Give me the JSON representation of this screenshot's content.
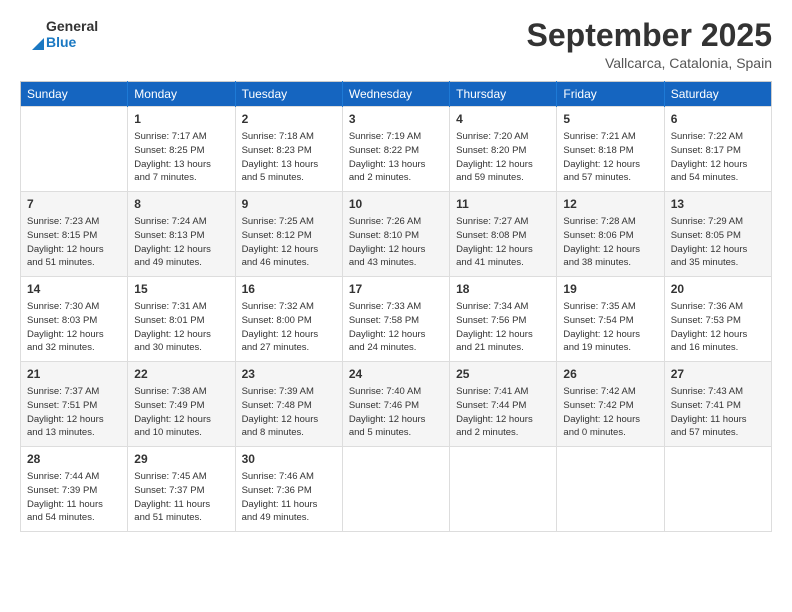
{
  "header": {
    "logo_line1": "General",
    "logo_line2": "Blue",
    "month": "September 2025",
    "location": "Vallcarca, Catalonia, Spain"
  },
  "days": [
    "Sunday",
    "Monday",
    "Tuesday",
    "Wednesday",
    "Thursday",
    "Friday",
    "Saturday"
  ],
  "weeks": [
    [
      {
        "date": "",
        "info": ""
      },
      {
        "date": "1",
        "info": "Sunrise: 7:17 AM\nSunset: 8:25 PM\nDaylight: 13 hours\nand 7 minutes."
      },
      {
        "date": "2",
        "info": "Sunrise: 7:18 AM\nSunset: 8:23 PM\nDaylight: 13 hours\nand 5 minutes."
      },
      {
        "date": "3",
        "info": "Sunrise: 7:19 AM\nSunset: 8:22 PM\nDaylight: 13 hours\nand 2 minutes."
      },
      {
        "date": "4",
        "info": "Sunrise: 7:20 AM\nSunset: 8:20 PM\nDaylight: 12 hours\nand 59 minutes."
      },
      {
        "date": "5",
        "info": "Sunrise: 7:21 AM\nSunset: 8:18 PM\nDaylight: 12 hours\nand 57 minutes."
      },
      {
        "date": "6",
        "info": "Sunrise: 7:22 AM\nSunset: 8:17 PM\nDaylight: 12 hours\nand 54 minutes."
      }
    ],
    [
      {
        "date": "7",
        "info": "Sunrise: 7:23 AM\nSunset: 8:15 PM\nDaylight: 12 hours\nand 51 minutes."
      },
      {
        "date": "8",
        "info": "Sunrise: 7:24 AM\nSunset: 8:13 PM\nDaylight: 12 hours\nand 49 minutes."
      },
      {
        "date": "9",
        "info": "Sunrise: 7:25 AM\nSunset: 8:12 PM\nDaylight: 12 hours\nand 46 minutes."
      },
      {
        "date": "10",
        "info": "Sunrise: 7:26 AM\nSunset: 8:10 PM\nDaylight: 12 hours\nand 43 minutes."
      },
      {
        "date": "11",
        "info": "Sunrise: 7:27 AM\nSunset: 8:08 PM\nDaylight: 12 hours\nand 41 minutes."
      },
      {
        "date": "12",
        "info": "Sunrise: 7:28 AM\nSunset: 8:06 PM\nDaylight: 12 hours\nand 38 minutes."
      },
      {
        "date": "13",
        "info": "Sunrise: 7:29 AM\nSunset: 8:05 PM\nDaylight: 12 hours\nand 35 minutes."
      }
    ],
    [
      {
        "date": "14",
        "info": "Sunrise: 7:30 AM\nSunset: 8:03 PM\nDaylight: 12 hours\nand 32 minutes."
      },
      {
        "date": "15",
        "info": "Sunrise: 7:31 AM\nSunset: 8:01 PM\nDaylight: 12 hours\nand 30 minutes."
      },
      {
        "date": "16",
        "info": "Sunrise: 7:32 AM\nSunset: 8:00 PM\nDaylight: 12 hours\nand 27 minutes."
      },
      {
        "date": "17",
        "info": "Sunrise: 7:33 AM\nSunset: 7:58 PM\nDaylight: 12 hours\nand 24 minutes."
      },
      {
        "date": "18",
        "info": "Sunrise: 7:34 AM\nSunset: 7:56 PM\nDaylight: 12 hours\nand 21 minutes."
      },
      {
        "date": "19",
        "info": "Sunrise: 7:35 AM\nSunset: 7:54 PM\nDaylight: 12 hours\nand 19 minutes."
      },
      {
        "date": "20",
        "info": "Sunrise: 7:36 AM\nSunset: 7:53 PM\nDaylight: 12 hours\nand 16 minutes."
      }
    ],
    [
      {
        "date": "21",
        "info": "Sunrise: 7:37 AM\nSunset: 7:51 PM\nDaylight: 12 hours\nand 13 minutes."
      },
      {
        "date": "22",
        "info": "Sunrise: 7:38 AM\nSunset: 7:49 PM\nDaylight: 12 hours\nand 10 minutes."
      },
      {
        "date": "23",
        "info": "Sunrise: 7:39 AM\nSunset: 7:48 PM\nDaylight: 12 hours\nand 8 minutes."
      },
      {
        "date": "24",
        "info": "Sunrise: 7:40 AM\nSunset: 7:46 PM\nDaylight: 12 hours\nand 5 minutes."
      },
      {
        "date": "25",
        "info": "Sunrise: 7:41 AM\nSunset: 7:44 PM\nDaylight: 12 hours\nand 2 minutes."
      },
      {
        "date": "26",
        "info": "Sunrise: 7:42 AM\nSunset: 7:42 PM\nDaylight: 12 hours\nand 0 minutes."
      },
      {
        "date": "27",
        "info": "Sunrise: 7:43 AM\nSunset: 7:41 PM\nDaylight: 11 hours\nand 57 minutes."
      }
    ],
    [
      {
        "date": "28",
        "info": "Sunrise: 7:44 AM\nSunset: 7:39 PM\nDaylight: 11 hours\nand 54 minutes."
      },
      {
        "date": "29",
        "info": "Sunrise: 7:45 AM\nSunset: 7:37 PM\nDaylight: 11 hours\nand 51 minutes."
      },
      {
        "date": "30",
        "info": "Sunrise: 7:46 AM\nSunset: 7:36 PM\nDaylight: 11 hours\nand 49 minutes."
      },
      {
        "date": "",
        "info": ""
      },
      {
        "date": "",
        "info": ""
      },
      {
        "date": "",
        "info": ""
      },
      {
        "date": "",
        "info": ""
      }
    ]
  ]
}
